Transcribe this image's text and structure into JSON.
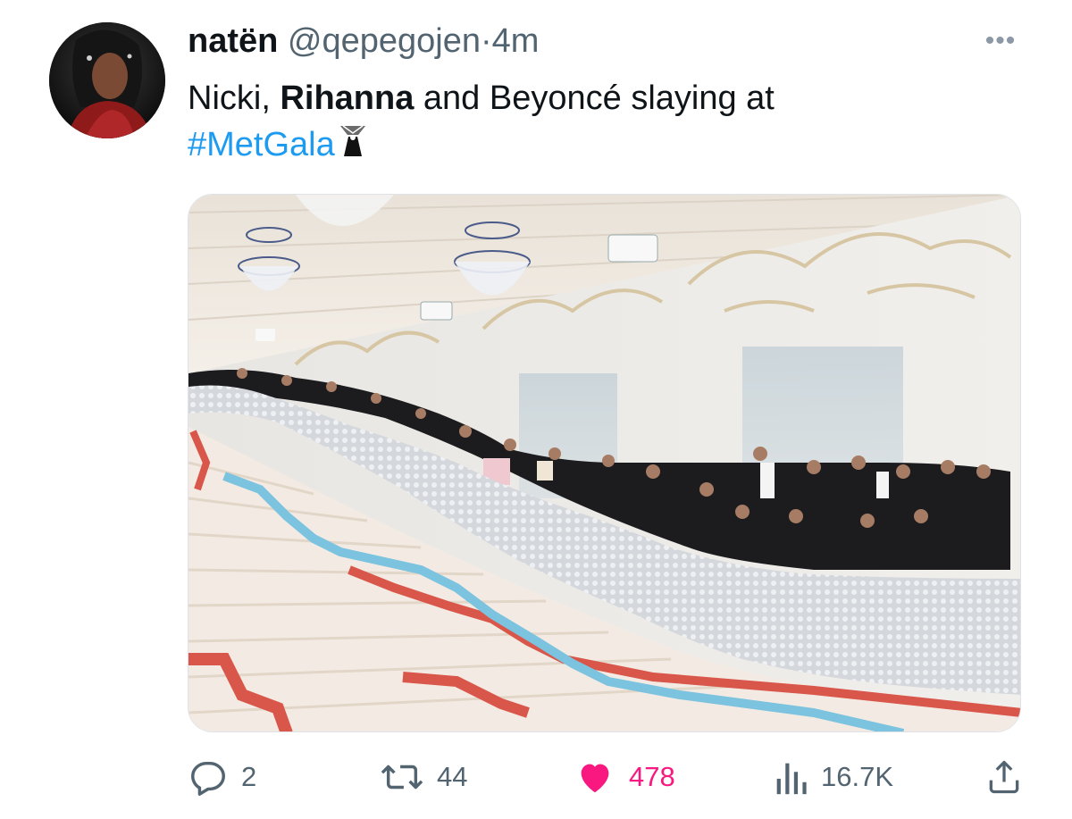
{
  "tweet": {
    "author_name": "natën",
    "handle": "@qepegojen",
    "separator": "·",
    "time": "4m",
    "text_part1": "Nicki, ",
    "text_bold": "Rihanna",
    "text_part2": " and Beyoncé slaying at",
    "hashtag": "#MetGala",
    "more_label": "•••"
  },
  "actions": {
    "replies": "2",
    "retweets": "44",
    "likes": "478",
    "views": "16.7K"
  },
  "colors": {
    "link_blue": "#1d9bf0",
    "like_pink": "#f91880",
    "muted_gray": "#536471"
  },
  "icons": {
    "reply": "reply-icon",
    "retweet": "retweet-icon",
    "like": "heart-icon",
    "views": "views-chart-icon",
    "share": "share-icon",
    "more": "more-icon",
    "hashflag": "met-gala-hashflag-icon"
  }
}
